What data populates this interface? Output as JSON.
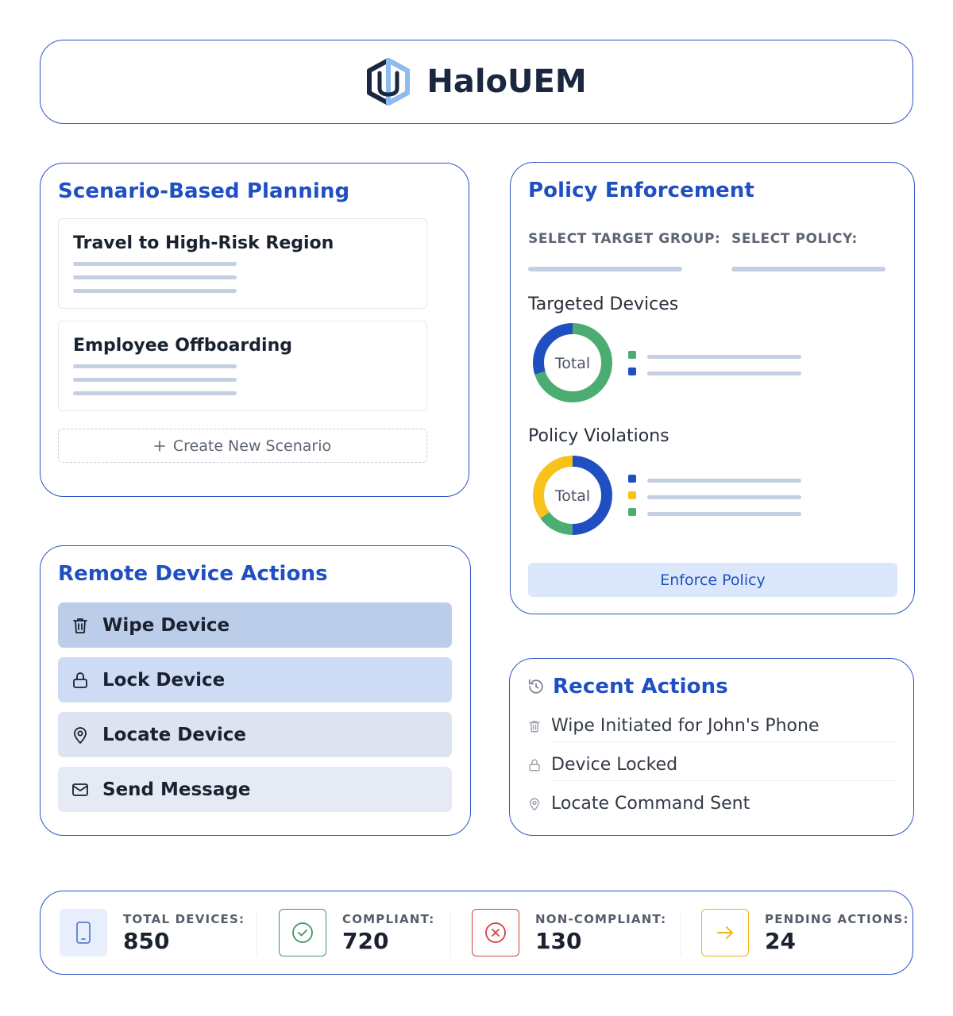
{
  "header": {
    "brand_name": "HaloUEM",
    "logo_icon": "hexagon-shield-logo"
  },
  "scenario": {
    "title": "Scenario-Based Planning",
    "items": [
      {
        "title": "Travel to High-Risk Region"
      },
      {
        "title": "Employee Offboarding"
      }
    ],
    "create_label": "Create New Scenario",
    "create_icon": "plus-icon"
  },
  "remote": {
    "title": "Remote Device Actions",
    "actions": [
      {
        "label": "Wipe Device",
        "icon": "trash-icon",
        "bg": "#bccde9"
      },
      {
        "label": "Lock Device",
        "icon": "lock-icon",
        "bg": "#cddcf4"
      },
      {
        "label": "Locate Device",
        "icon": "map-pin-icon",
        "bg": "#dde3f1"
      },
      {
        "label": "Send Message",
        "icon": "mail-icon",
        "bg": "#e6eaf4"
      }
    ]
  },
  "policy": {
    "title": "Policy Enforcement",
    "select_group_label": "SELECT TARGET GROUP:",
    "select_policy_label": "SELECT POLICY:",
    "targeted": {
      "title": "Targeted Devices",
      "center_label": "Total",
      "segments": [
        {
          "color": "#4cad72",
          "fraction": 0.7
        },
        {
          "color": "#1f4fc1",
          "fraction": 0.3
        }
      ]
    },
    "violations": {
      "title": "Policy Violations",
      "center_label": "Total",
      "segments": [
        {
          "color": "#1f4fc1",
          "fraction": 0.5
        },
        {
          "color": "#4cad72",
          "fraction": 0.15
        },
        {
          "color": "#f7c21a",
          "fraction": 0.35
        }
      ]
    },
    "enforce_label": "Enforce Policy"
  },
  "recent": {
    "title": "Recent Actions",
    "title_icon": "history-icon",
    "items": [
      {
        "label": "Wipe Initiated for John's Phone",
        "icon": "trash-icon"
      },
      {
        "label": "Device Locked",
        "icon": "lock-icon"
      },
      {
        "label": "Locate Command Sent",
        "icon": "map-pin-icon"
      }
    ]
  },
  "stats": [
    {
      "label": "TOTAL DEVICES:",
      "value": "850",
      "icon": "phone-icon",
      "color": "#5a7fd6"
    },
    {
      "label": "COMPLIANT:",
      "value": "720",
      "icon": "check-circle-icon",
      "color": "#3b9a63"
    },
    {
      "label": "NON-COMPLIANT:",
      "value": "130",
      "icon": "x-circle-icon",
      "color": "#d64040"
    },
    {
      "label": "PENDING ACTIONS:",
      "value": "24",
      "icon": "arrow-right-icon",
      "color": "#efb314"
    }
  ]
}
